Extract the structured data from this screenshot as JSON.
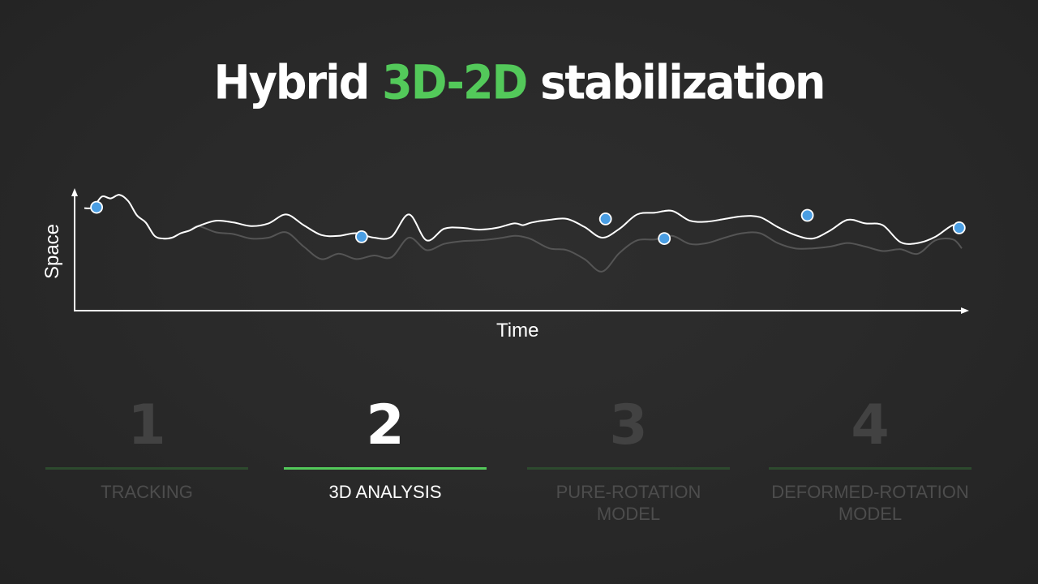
{
  "title": {
    "prefix": "Hybrid ",
    "accent": "3D-2D",
    "suffix": " stabilization"
  },
  "colors": {
    "background": "#2a2a2a",
    "accent": "#53c95a",
    "keypoint": "#4a9ee3",
    "inactive": "#424242"
  },
  "chart_data": {
    "type": "line",
    "xlabel": "Time",
    "ylabel": "Space",
    "xlim": [
      0,
      100
    ],
    "ylim": [
      0,
      100
    ],
    "grid": false,
    "series": [
      {
        "x": [
          0,
          1,
          2,
          3,
          4,
          5,
          6,
          7,
          8,
          9,
          10,
          11,
          12,
          13,
          15,
          17,
          19,
          21,
          23,
          25,
          27,
          29,
          31,
          33,
          35,
          37,
          39,
          41,
          43,
          45,
          47,
          49,
          50,
          51,
          53,
          55,
          57,
          59,
          61,
          63,
          65,
          67,
          69,
          71,
          73,
          75,
          77,
          79,
          81,
          83,
          85,
          87,
          89,
          91,
          93,
          95,
          97,
          99,
          100
        ],
        "values": [
          83,
          84,
          96,
          94,
          98,
          91,
          75,
          67,
          52,
          49,
          50,
          55,
          58,
          63,
          69,
          67,
          63,
          66,
          76,
          64,
          53,
          52,
          55,
          50,
          51,
          76,
          47,
          60,
          61,
          59,
          61,
          66,
          64,
          67,
          70,
          71,
          62,
          50,
          60,
          76,
          78,
          80,
          69,
          68,
          71,
          74,
          73,
          62,
          53,
          49,
          58,
          70,
          66,
          64,
          45,
          44,
          51,
          64,
          58
        ]
      },
      {
        "x": [
          0,
          1,
          2,
          3,
          4,
          5,
          6,
          7,
          8,
          9,
          10,
          11,
          12,
          13,
          15,
          17,
          19,
          21,
          23,
          25,
          27,
          29,
          31,
          33,
          35,
          37,
          39,
          41,
          43,
          45,
          47,
          49,
          50,
          51,
          53,
          55,
          57,
          59,
          61,
          63,
          65,
          67,
          69,
          71,
          73,
          75,
          77,
          79,
          81,
          83,
          85,
          87,
          89,
          91,
          93,
          95,
          97,
          99,
          100
        ],
        "values": [
          83,
          84,
          96,
          94,
          98,
          91,
          75,
          67,
          52,
          49,
          50,
          55,
          58,
          63,
          56,
          54,
          49,
          50,
          56,
          40,
          26,
          32,
          26,
          30,
          28,
          50,
          36,
          43,
          46,
          47,
          49,
          52,
          51,
          48,
          38,
          36,
          26,
          12,
          33,
          47,
          48,
          52,
          43,
          44,
          50,
          55,
          55,
          44,
          38,
          38,
          40,
          44,
          40,
          35,
          37,
          32,
          47,
          48,
          38
        ]
      }
    ],
    "keypoints": {
      "x": [
        1.4,
        31.6,
        59.4,
        66.1,
        82.4,
        99.7
      ],
      "values": [
        84,
        51,
        71,
        49,
        75,
        61
      ]
    }
  },
  "steps": [
    {
      "number": "1",
      "label": "TRACKING",
      "active": false
    },
    {
      "number": "2",
      "label": "3D ANALYSIS",
      "active": true
    },
    {
      "number": "3",
      "label": "PURE-ROTATION\nMODEL",
      "active": false
    },
    {
      "number": "4",
      "label": "DEFORMED-ROTATION\nMODEL",
      "active": false
    }
  ]
}
